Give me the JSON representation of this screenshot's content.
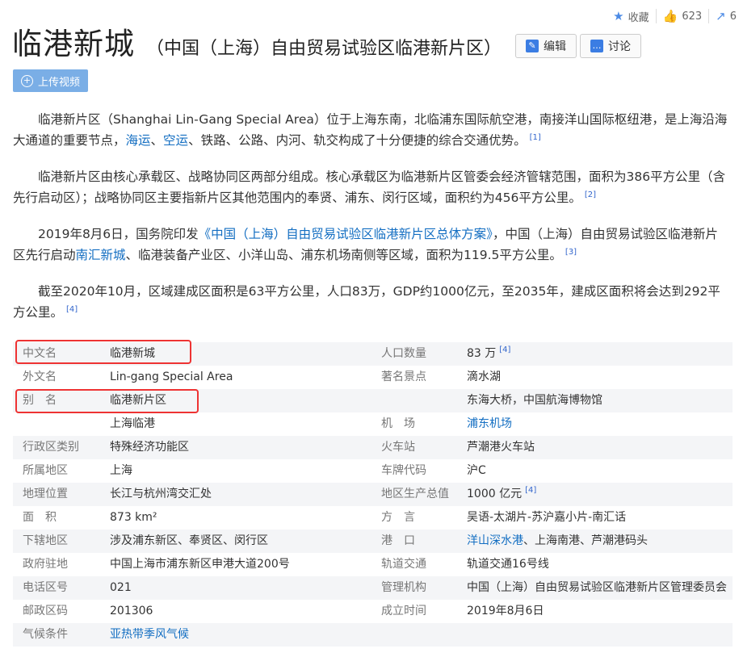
{
  "topbar": {
    "collect": "收藏",
    "likes": "623",
    "share_count": "6"
  },
  "title": {
    "main": "临港新城",
    "sub": "（中国（上海）自由贸易试验区临港新片区）"
  },
  "buttons": {
    "edit": "编辑",
    "discuss": "讨论",
    "upload_video": "上传视频"
  },
  "paragraphs": {
    "p1": {
      "t1": "临港新片区（Shanghai Lin-Gang Special Area）位于上海东南，北临浦东国际航空港，南接洋山国际枢纽港，是上海沿海大通道的重要节点，",
      "l1": "海运",
      "t2": "、",
      "l2": "空运",
      "t3": "、铁路、公路、内河、轨交构成了十分便捷的综合交通优势。",
      "ref": "[1]"
    },
    "p2": {
      "t1": "临港新片区由核心承载区、战略协同区两部分组成。核心承载区为临港新片区管委会经济管辖范围，面积为386平方公里（含先行启动区）；战略协同区主要指新片区其他范围内的奉贤、浦东、闵行区域，面积约为456平方公里。",
      "ref": "[2]"
    },
    "p3": {
      "t1": "2019年8月6日，国务院印发",
      "l1": "《中国（上海）自由贸易试验区临港新片区总体方案》",
      "t2": "，中国（上海）自由贸易试验区临港新片区先行启动",
      "l2": "南汇新城",
      "t3": "、临港装备产业区、小洋山岛、浦东机场南侧等区域，面积为119.5平方公里。",
      "ref": "[3]"
    },
    "p4": {
      "t1": "截至2020年10月，区域建成区面积是63平方公里，人口83万，GDP约1000亿元，至2035年，建成区面积将会达到292平方公里。",
      "ref": "[4]"
    }
  },
  "info": {
    "r1": {
      "k1": "中文名",
      "v1": "临港新城",
      "k2": "人口数量",
      "v2": "83 万",
      "ref": "[4]"
    },
    "r2": {
      "k1": "外文名",
      "v1": "Lin-gang Special Area",
      "k2": "著名景点",
      "v2": "滴水湖"
    },
    "r3": {
      "k1": "别　名",
      "v1": "临港新片区",
      "k2": "",
      "v2": "东海大桥，中国航海博物馆"
    },
    "r4": {
      "k1": "",
      "v1": "上海临港",
      "k2": "机　场",
      "v2": "浦东机场"
    },
    "r5": {
      "k1": "行政区类别",
      "v1": "特殊经济功能区",
      "k2": "火车站",
      "v2": "芦潮港火车站"
    },
    "r6": {
      "k1": "所属地区",
      "v1": "上海",
      "k2": "车牌代码",
      "v2": "沪C"
    },
    "r7": {
      "k1": "地理位置",
      "v1": "长江与杭州湾交汇处",
      "k2": "地区生产总值",
      "v2": "1000 亿元",
      "ref": "[4]"
    },
    "r8": {
      "k1": "面　积",
      "v1": "873 km²",
      "k2": "方　言",
      "v2": "吴语-太湖片-苏沪嘉小片-南汇话"
    },
    "r9": {
      "k1": "下辖地区",
      "v1": "涉及浦东新区、奉贤区、闵行区",
      "k2": "港　口",
      "v2a": "洋山深水港",
      "v2b": "、上海南港、芦潮港码头"
    },
    "r10": {
      "k1": "政府驻地",
      "v1": "中国上海市浦东新区申港大道200号",
      "k2": "轨道交通",
      "v2": "轨道交通16号线"
    },
    "r11": {
      "k1": "电话区号",
      "v1": "021",
      "k2": "管理机构",
      "v2": "中国（上海）自由贸易试验区临港新片区管理委员会"
    },
    "r12": {
      "k1": "邮政区码",
      "v1": "201306",
      "k2": "成立时间",
      "v2": "2019年8月6日"
    },
    "r13": {
      "k1": "气候条件",
      "v1": "亚热带季风气候",
      "k2": "",
      "v2": ""
    }
  },
  "colors": {
    "link": "#136ec2",
    "highlight_box": "#e33333",
    "upload_bg": "#7aaee6"
  }
}
